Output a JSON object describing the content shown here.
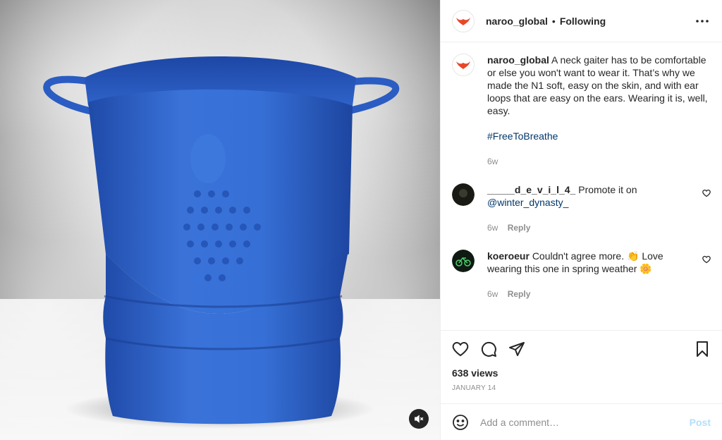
{
  "post": {
    "username": "naroo_global",
    "separator": "•",
    "follow_status": "Following",
    "caption": "A neck gaiter has to be comfortable or else you won't want to wear it. That’s why we made the N1 soft, easy on the skin, and with ear loops that are easy on the ears. Wearing it is, well, easy.",
    "hashtag": "#FreeToBreathe",
    "caption_age": "6w",
    "views": "638 views",
    "date": "JANUARY 14"
  },
  "comments": [
    {
      "username": "_____d_e_v_i_l_4_",
      "text": "Promote it on",
      "mention": "@winter_dynasty_",
      "age": "6w",
      "reply_label": "Reply"
    },
    {
      "username": "koeroeur",
      "text": "Couldn't agree more. 👏 Love wearing this one in spring weather 🌼",
      "age": "6w",
      "reply_label": "Reply"
    }
  ],
  "composer": {
    "placeholder": "Add a comment…",
    "post_label": "Post"
  },
  "colors": {
    "brand": "#e8472a",
    "link": "#00376b",
    "muted": "#8e8e8e",
    "post_disabled": "#b2dffc",
    "gaiter_blue": "#2f63c9"
  },
  "icons": [
    "naroo-logo-icon",
    "more-options-icon",
    "heart-icon",
    "comment-icon",
    "share-icon",
    "bookmark-icon",
    "emoji-icon",
    "mute-icon"
  ]
}
